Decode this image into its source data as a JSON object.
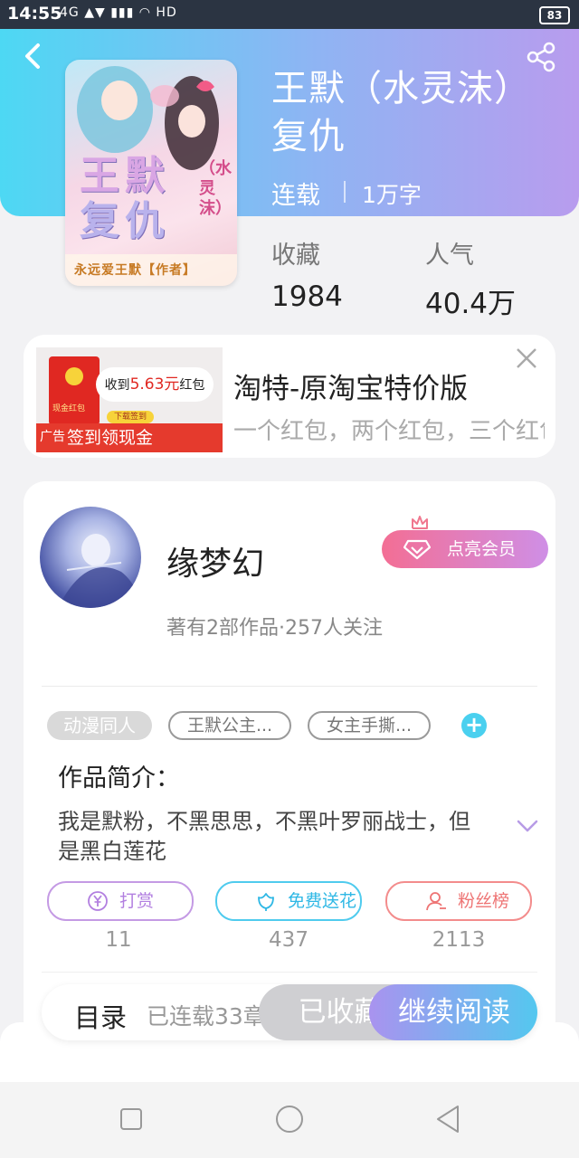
{
  "status_bar": {
    "time": "14:55",
    "network_icons": "4G ▲▼ ▮▮▮ ◠ HD",
    "battery": "83"
  },
  "header": {
    "back_icon": "chevron-left-icon",
    "share_icon": "share-icon"
  },
  "book": {
    "cover": {
      "title_line1": "王默",
      "title_line2": "复仇",
      "subtitle": "（水灵沫）",
      "author_line": "永远爱王默【作者】"
    },
    "title": "王默（水灵沫）复仇",
    "status": "连载",
    "word_count": "1万字",
    "favorites_label": "收藏",
    "favorites_value": "1984",
    "popularity_label": "人气",
    "popularity_value": "40.4万"
  },
  "ad": {
    "image": {
      "bubble_prefix": "收到",
      "bubble_amount": "5.63元",
      "bubble_suffix": "红包",
      "envelope_text": "现金红包",
      "download_label": "下载签到",
      "banner_text": "签到领现金",
      "badge": "广告"
    },
    "title": "淘特-原淘宝特价版",
    "description": "一个红包，两个红包，三个红包",
    "close_icon": "close-icon"
  },
  "author": {
    "name": "缘梦幻",
    "stats": "著有2部作品·257人关注",
    "vip_button": "点亮会员",
    "vip_icon": "diamond-icon",
    "crown_icon": "crown-icon"
  },
  "tags": [
    "动漫同人",
    "王默公主...",
    "女主手撕..."
  ],
  "intro": {
    "heading": "作品简介：",
    "text": "我是默粉，不黑思思，不黑叶罗丽战士，但是黑白莲花"
  },
  "actions": [
    {
      "label": "打赏",
      "count": "11",
      "icon": "yen-icon"
    },
    {
      "label": "免费送花",
      "count": "437",
      "icon": "flower-icon"
    },
    {
      "label": "粉丝榜",
      "count": "2113",
      "icon": "person-icon"
    }
  ],
  "bottom_bar": {
    "toc_label": "目录",
    "toc_status": "已连载33章",
    "collected_label": "已收藏",
    "continue_label": "继续阅读"
  },
  "colors": {
    "header_start": "#4dd8f3",
    "header_end": "#b89cee",
    "reward": "#b27fe0",
    "flower": "#2fb8e5",
    "fans": "#ee7474",
    "vip_start": "#f36e94",
    "vip_end": "#cf8fe6"
  }
}
